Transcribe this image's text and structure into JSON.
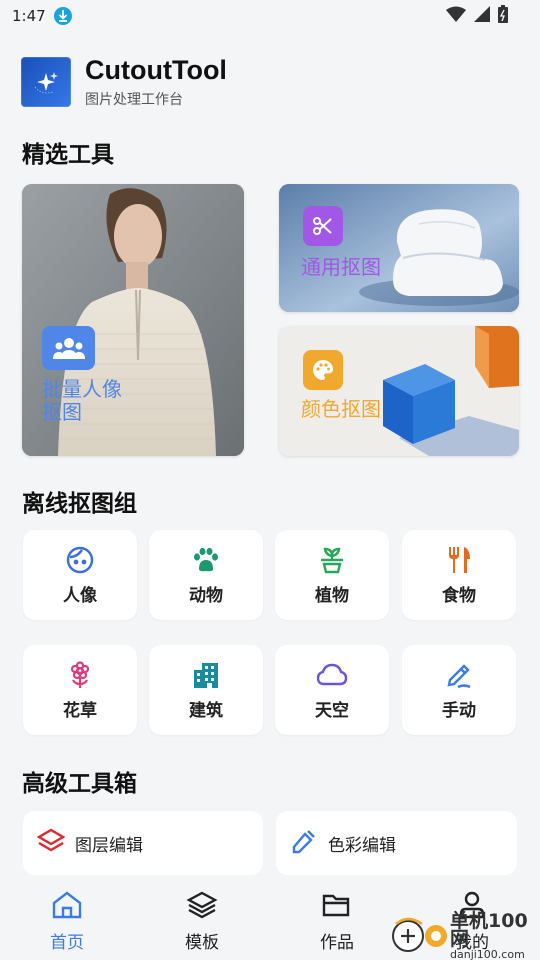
{
  "status": {
    "time": "1:47"
  },
  "app": {
    "title": "CutoutTool",
    "subtitle": "图片处理工作台"
  },
  "featured": {
    "title": "精选工具",
    "portrait": {
      "label_line1": "批量人像",
      "label_line2": "抠图",
      "icon": "people-icon",
      "color": "#4f86e8"
    },
    "general": {
      "label": "通用抠图",
      "icon": "scissors-icon",
      "color": "#a257e6"
    },
    "color": {
      "label": "颜色抠图",
      "icon": "palette-icon",
      "color": "#f0a92d"
    }
  },
  "offline": {
    "title": "离线抠图组",
    "items": [
      {
        "label": "人像",
        "icon": "face-icon",
        "color": "#3a6fdc"
      },
      {
        "label": "动物",
        "icon": "paw-icon",
        "color": "#1c9a6e"
      },
      {
        "label": "植物",
        "icon": "potted-plant-icon",
        "color": "#2aa65a"
      },
      {
        "label": "食物",
        "icon": "fork-knife-icon",
        "color": "#e36a22"
      },
      {
        "label": "花草",
        "icon": "flower-icon",
        "color": "#df3a7c"
      },
      {
        "label": "建筑",
        "icon": "building-icon",
        "color": "#1b8a9c"
      },
      {
        "label": "天空",
        "icon": "cloud-icon",
        "color": "#6a55d8"
      },
      {
        "label": "手动",
        "icon": "pen-icon",
        "color": "#3b7be8"
      }
    ]
  },
  "advanced": {
    "title": "高级工具箱",
    "items": [
      {
        "label": "图层编辑",
        "icon": "layers-icon",
        "color": "#e0282f"
      },
      {
        "label": "色彩编辑",
        "icon": "eyedropper-icon",
        "color": "#3b7be8"
      }
    ]
  },
  "nav": {
    "items": [
      {
        "label": "首页",
        "icon": "home-icon",
        "active": true
      },
      {
        "label": "模板",
        "icon": "stack-icon",
        "active": false
      },
      {
        "label": "作品",
        "icon": "folder-icon",
        "active": false
      },
      {
        "label": "我的",
        "icon": "user-icon",
        "active": false
      }
    ]
  },
  "watermark": {
    "text": "单机100网",
    "url": "danji100.com"
  },
  "colors": {
    "accent": "#3b7be8",
    "background": "#f4f5f7"
  }
}
